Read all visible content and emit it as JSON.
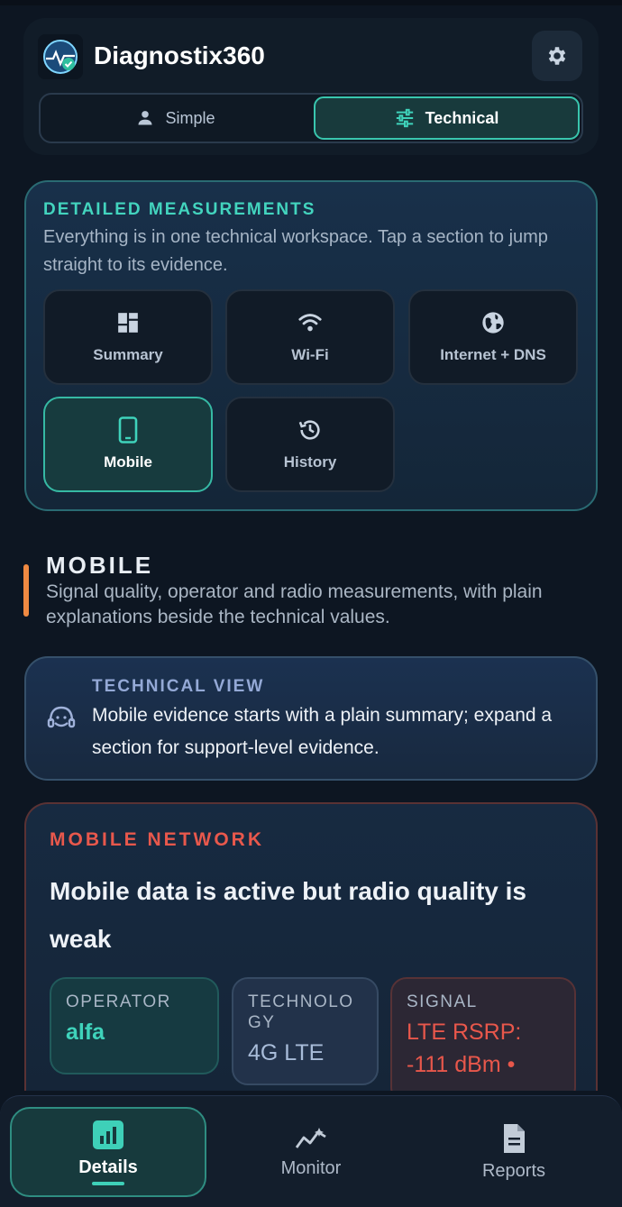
{
  "app": {
    "title": "Diagnostix360",
    "logo_icon": "diagnostix-logo",
    "settings_icon": "gear-icon"
  },
  "mode_toggle": {
    "simple_label": "Simple",
    "technical_label": "Technical",
    "selected": "Technical"
  },
  "measurements": {
    "title": "DETAILED MEASUREMENTS",
    "description": "Everything is in one technical workspace. Tap a section to jump straight to its evidence.",
    "tiles": [
      {
        "label": "Summary",
        "icon": "dashboard-icon"
      },
      {
        "label": "Wi-Fi",
        "icon": "wifi-icon"
      },
      {
        "label": "Internet + DNS",
        "icon": "globe-icon"
      },
      {
        "label": "Mobile",
        "icon": "phone-icon"
      },
      {
        "label": "History",
        "icon": "history-icon"
      }
    ],
    "active_tile": "Mobile"
  },
  "section": {
    "title": "MOBILE",
    "description": "Signal quality, operator and radio measurements, with plain explanations beside the technical values."
  },
  "technical_view": {
    "title": "TECHNICAL VIEW",
    "text": "Mobile evidence starts with a plain summary; expand a section for support-level evidence."
  },
  "network": {
    "label": "MOBILE NETWORK",
    "headline": "Mobile data is active but radio quality is weak",
    "operator_label": "OPERATOR",
    "operator_value": "alfa",
    "technology_label": "TECHNOLOGY",
    "technology_value": "4G LTE",
    "signal_label": "SIGNAL",
    "signal_value": "LTE RSRP: -111 dBm •"
  },
  "bottom_nav": {
    "items": [
      {
        "label": "Details",
        "icon": "bar-chart-icon"
      },
      {
        "label": "Monitor",
        "icon": "trend-icon"
      },
      {
        "label": "Reports",
        "icon": "document-icon"
      }
    ],
    "active": "Details"
  },
  "colors": {
    "accent": "#3fd3bb",
    "warning": "#e8574b",
    "section_bar": "#f08a42",
    "background": "#0d1622"
  }
}
